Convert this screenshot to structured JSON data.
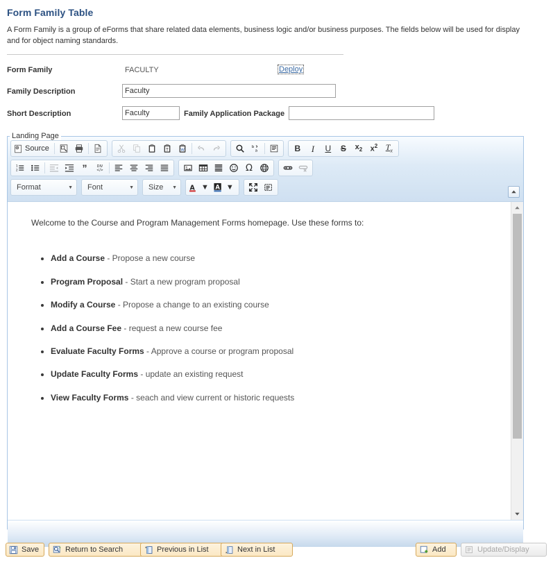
{
  "page": {
    "title": "Form Family Table",
    "description": "A Form Family is a group of eForms that share related data elements, business logic and/or business purposes. The fields below will be used for display and for object naming standards."
  },
  "fields": {
    "form_family_label": "Form Family",
    "form_family_value": "FACULTY",
    "deploy_link": "Deploy",
    "family_description_label": "Family Description",
    "family_description_value": "Faculty",
    "short_description_label": "Short Description",
    "short_description_value": "Faculty",
    "family_application_package_label": "Family Application Package",
    "family_application_package_value": ""
  },
  "editor": {
    "legend": "Landing Page",
    "source_label": "Source",
    "format_label": "Format",
    "font_label": "Font",
    "size_label": "Size",
    "toolbar_row1": [
      "source-button",
      "templates-button",
      "print-button",
      "new-page-button",
      "cut-button",
      "copy-button",
      "paste-button",
      "paste-text-button",
      "paste-word-button",
      "undo-button",
      "redo-button",
      "find-button",
      "replace-button",
      "select-all-button",
      "bold-button",
      "italic-button",
      "underline-button",
      "strikethrough-button",
      "subscript-button",
      "superscript-button",
      "remove-format-button"
    ],
    "toolbar_row2": [
      "numbered-list-button",
      "bulleted-list-button",
      "outdent-button",
      "indent-button",
      "blockquote-button",
      "div-container-button",
      "align-left-button",
      "align-center-button",
      "align-right-button",
      "justify-button",
      "image-button",
      "table-button",
      "horizontal-rule-button",
      "smiley-button",
      "special-char-button",
      "page-break-button",
      "link-button",
      "unlink-button"
    ],
    "toolbar_row3": [
      "format-dropdown",
      "font-dropdown",
      "size-dropdown",
      "text-color-button",
      "background-color-button",
      "maximize-button",
      "show-blocks-button",
      "collapse-toolbar-button"
    ],
    "content": {
      "intro": "Welcome to the Course and Program Management Forms homepage. Use these forms to:",
      "items": [
        {
          "term": "Add a Course",
          "desc": " - Propose a new course"
        },
        {
          "term": "Program Proposal",
          "desc": " - Start a new program proposal"
        },
        {
          "term": "Modify a Course",
          "desc": " - Propose a change to an existing course"
        },
        {
          "term": "Add a Course Fee",
          "desc": " -  request a new course fee"
        },
        {
          "term": "Evaluate Faculty Forms",
          "desc": " - Approve a course or program proposal"
        },
        {
          "term": "Update Faculty Forms",
          "desc": " - update an existing request"
        },
        {
          "term": "View Faculty Forms",
          "desc": " - seach and view current or historic requests"
        }
      ]
    }
  },
  "buttons": {
    "save": "Save",
    "return_to_search": "Return to Search",
    "previous_in_list": "Previous in List",
    "next_in_list": "Next in List",
    "add": "Add",
    "update_display": "Update/Display"
  },
  "colors": {
    "title": "#2c5182",
    "link": "#3b6ba5",
    "button_border": "#d6a95c",
    "editor_border": "#a8c6e5"
  }
}
